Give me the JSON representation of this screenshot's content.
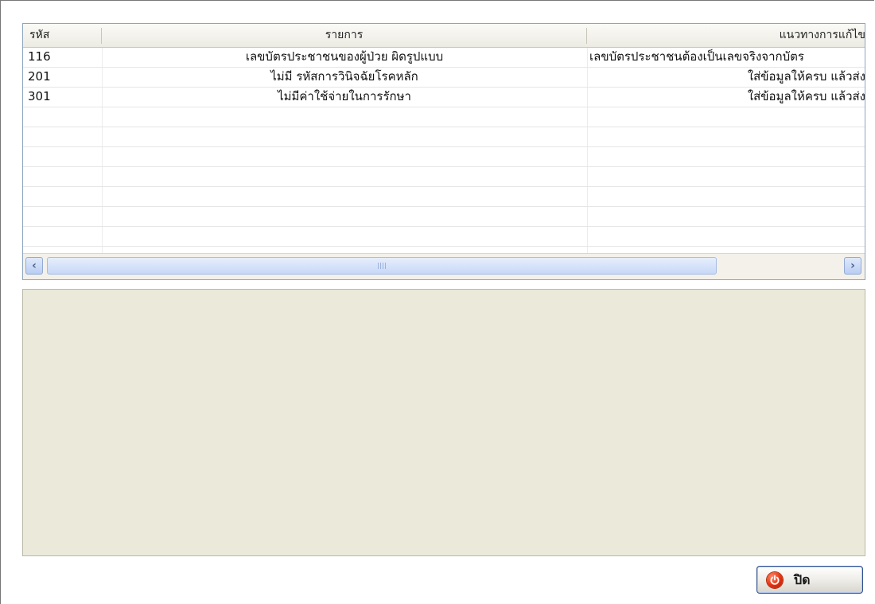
{
  "grid": {
    "columns": [
      {
        "label": "รหัส"
      },
      {
        "label": "รายการ"
      },
      {
        "label": "แนวทางการแก้ไข"
      }
    ],
    "rows": [
      {
        "code": "116",
        "item": "เลขบัตรประชาชนของผู้ป่วย ผิดรูปแบบ",
        "solution": "เลขบัตรประชาชนต้องเป็นเลขจริงจากบัตร"
      },
      {
        "code": "201",
        "item": "ไม่มี รหัสการวินิจฉัยโรคหลัก",
        "solution": "ใส่ข้อมูลให้ครบ แล้วส่ง"
      },
      {
        "code": "301",
        "item": "ไม่มีค่าใช้จ่ายในการรักษา",
        "solution": "ใส่ข้อมูลให้ครบ แล้วส่ง"
      }
    ],
    "scrollbar": {
      "left_icon": "chevron-left-icon",
      "right_icon": "chevron-right-icon"
    }
  },
  "close_button": {
    "label": "ปิด",
    "icon": "power-icon",
    "icon_color": "#e23010"
  }
}
